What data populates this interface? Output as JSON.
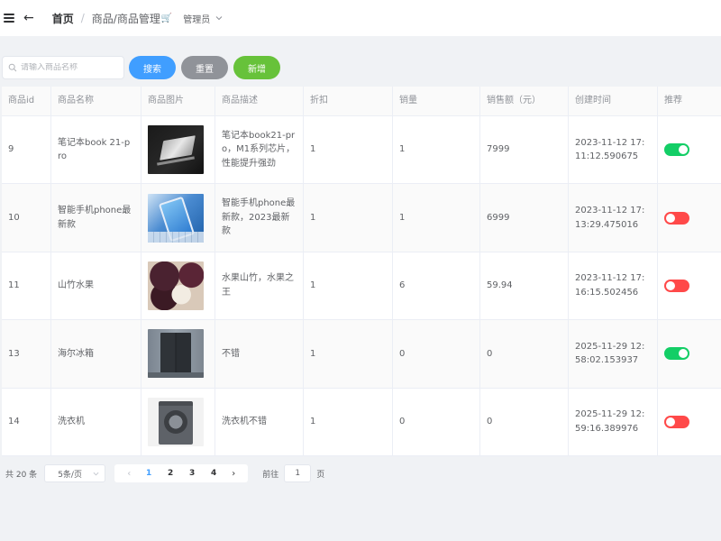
{
  "header": {
    "home": "首页",
    "separator": "/",
    "current": "商品/商品管理",
    "current_emoji": "🛒",
    "user": "管理员"
  },
  "toolbar": {
    "search_placeholder": "请输入商品名称",
    "search_label": "搜索",
    "reset_label": "重置",
    "add_label": "新增"
  },
  "table": {
    "columns": [
      "商品id",
      "商品名称",
      "商品图片",
      "商品描述",
      "折扣",
      "销量",
      "销售额（元）",
      "创建时间",
      "推荐"
    ],
    "rows": [
      {
        "id": "9",
        "name": "笔记本book 21-pro",
        "image": "laptop",
        "desc": "笔记本book21-pro，M1系列芯片，性能提升强劲",
        "discount": "1",
        "sales": "1",
        "amount": "7999",
        "created": "2023-11-12 17:11:12.590675",
        "recommend": true
      },
      {
        "id": "10",
        "name": "智能手机phone最新款",
        "image": "phone",
        "desc": "智能手机phone最新款，2023最新款",
        "discount": "1",
        "sales": "1",
        "amount": "6999",
        "created": "2023-11-12 17:13:29.475016",
        "recommend": false
      },
      {
        "id": "11",
        "name": "山竹水果",
        "image": "fruit",
        "desc": "水果山竹，水果之王",
        "discount": "1",
        "sales": "6",
        "amount": "59.94",
        "created": "2023-11-12 17:16:15.502456",
        "recommend": false
      },
      {
        "id": "13",
        "name": "海尔冰箱",
        "image": "fridge",
        "desc": "不错",
        "discount": "1",
        "sales": "0",
        "amount": "0",
        "created": "2025-11-29 12:58:02.153937",
        "recommend": true
      },
      {
        "id": "14",
        "name": "洗衣机",
        "image": "washer",
        "desc": "洗衣机不错",
        "discount": "1",
        "sales": "0",
        "amount": "0",
        "created": "2025-11-29 12:59:16.389976",
        "recommend": false
      }
    ]
  },
  "pagination": {
    "total": "共 20 条",
    "page_size": "5条/页",
    "pages": [
      "1",
      "2",
      "3",
      "4"
    ],
    "current_page": "1",
    "prev": "‹",
    "next": "›",
    "goto_label": "前往",
    "goto_value": "1",
    "page_unit": "页"
  },
  "colors": {
    "primary": "#409eff",
    "reset": "#909399",
    "add": "#67c23a",
    "switch_on": "#13ce66",
    "switch_off": "#ff4949"
  }
}
